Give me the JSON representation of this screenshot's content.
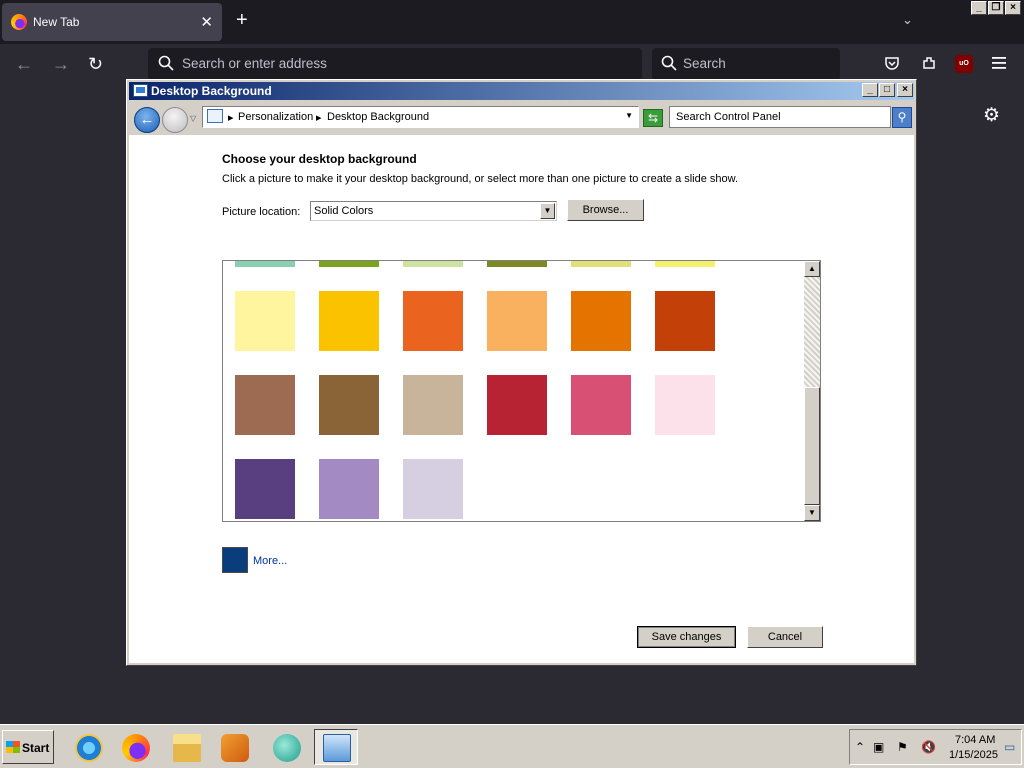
{
  "browser": {
    "tab_title": "New Tab",
    "address_placeholder": "Search or enter address",
    "search_placeholder": "Search"
  },
  "window": {
    "title": "Desktop Background",
    "breadcrumb": [
      "Personalization",
      "Desktop Background"
    ],
    "search_placeholder": "Search Control Panel"
  },
  "content": {
    "heading": "Choose your desktop background",
    "instruction": "Click a picture to make it your desktop background, or select more than one picture to create a slide show.",
    "picture_location_label": "Picture location:",
    "picture_location_value": "Solid Colors",
    "browse_label": "Browse...",
    "more_label": "More...",
    "more_color": "#0a3d7c",
    "save_label": "Save changes",
    "cancel_label": "Cancel"
  },
  "swatches": {
    "partial_row": [
      "#8ccfb0",
      "#7aa321",
      "#cfe3a0",
      "#7c8a26",
      "#dfe07a",
      "#f4f070"
    ],
    "rows": [
      [
        "#fff59e",
        "#fbc200",
        "#ea6420",
        "#f9b160",
        "#e57300",
        "#c44009"
      ],
      [
        "#9c6b52",
        "#8a6436",
        "#c7b49a",
        "#b82334",
        "#d85174",
        "#fde1ea"
      ],
      [
        "#5a3f80",
        "#a48ac2",
        "#d6cfe2"
      ]
    ]
  },
  "taskbar": {
    "start_label": "Start",
    "time": "7:04 AM",
    "date": "1/15/2025"
  }
}
